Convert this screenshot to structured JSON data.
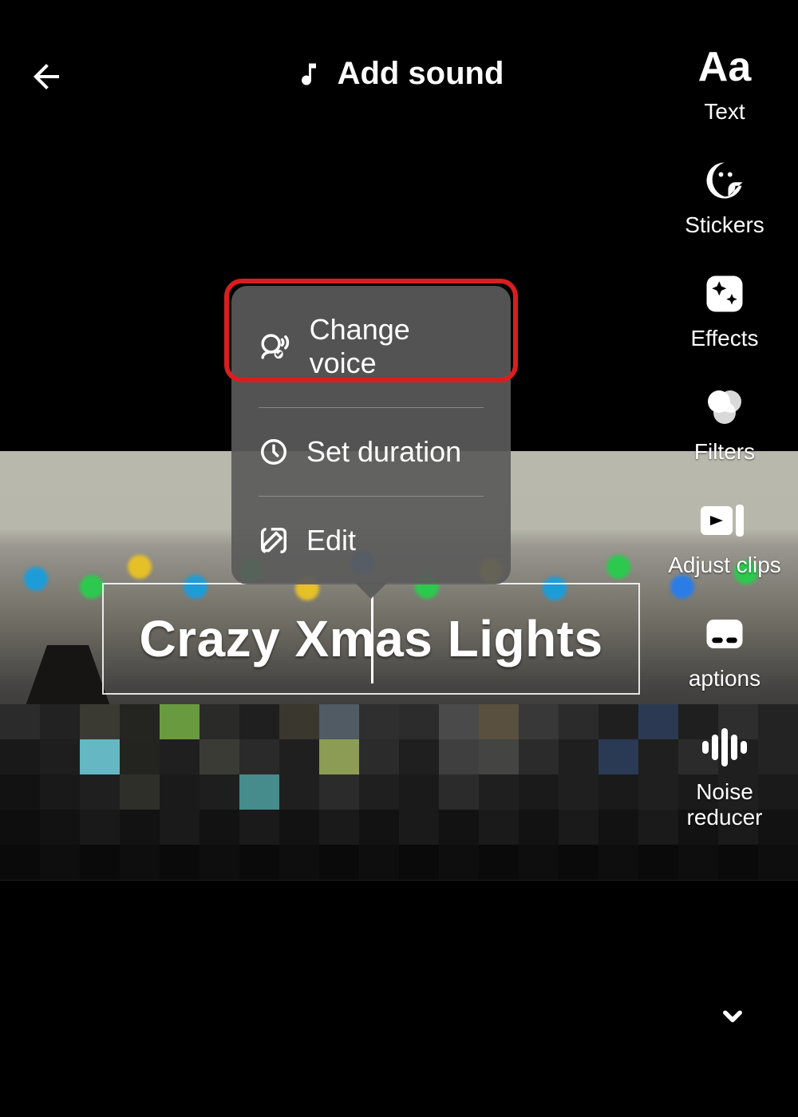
{
  "header": {
    "add_sound_label": "Add sound"
  },
  "toolbar": {
    "text": "Text",
    "stickers": "Stickers",
    "effects": "Effects",
    "filters": "Filters",
    "adjust_clips": "Adjust clips",
    "captions": "aptions",
    "noise_reducer": "Noise\nreducer"
  },
  "popup": {
    "change_voice": "Change voice",
    "set_duration": "Set duration",
    "edit": "Edit"
  },
  "text_overlay": {
    "content": "Crazy Xmas Lights"
  }
}
